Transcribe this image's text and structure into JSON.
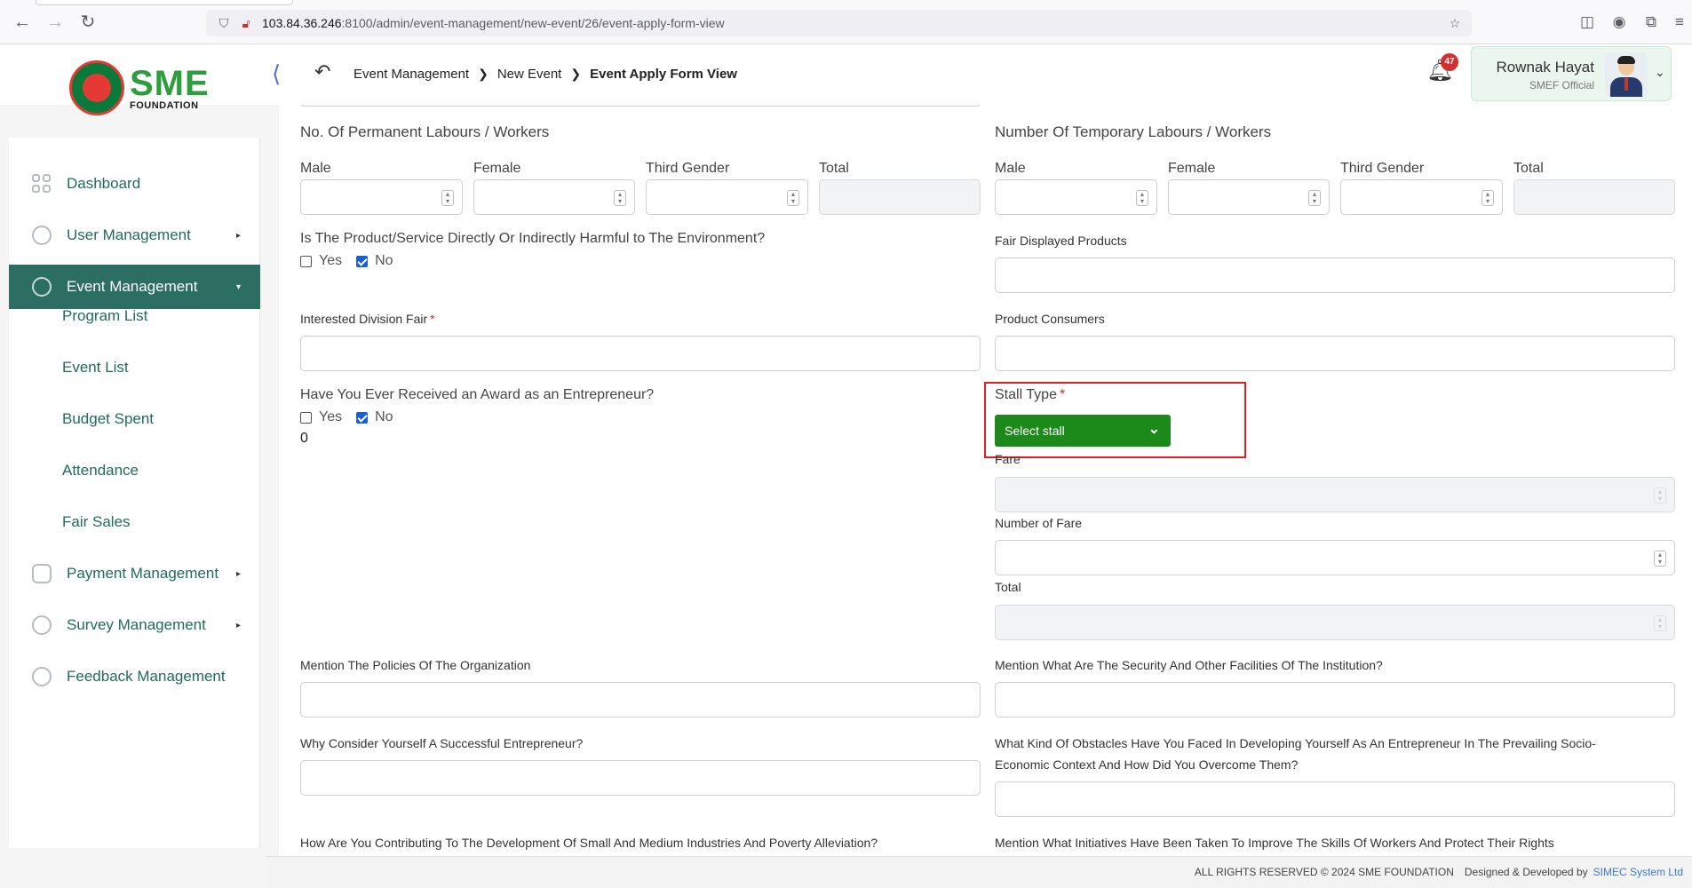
{
  "browser": {
    "url_host": "103.84.36.246",
    "url_rest": ":8100/admin/event-management/new-event/26/event-apply-form-view"
  },
  "brand": {
    "logo_text": "SME",
    "logo_sub": "FOUNDATION"
  },
  "header": {
    "breadcrumb": [
      "Event Management",
      "New Event",
      "Event Apply Form View"
    ],
    "notification_count": "47",
    "user_name": "Rownak Hayat",
    "user_role": "SMEF Official"
  },
  "sidebar": {
    "items": [
      {
        "label": "Dashboard",
        "icon": "dashboard-icon"
      },
      {
        "label": "User Management",
        "icon": "user-shield-icon",
        "caret": "▸"
      },
      {
        "label": "Event Management",
        "icon": "event-lock-icon",
        "caret": "▾",
        "active": true
      },
      {
        "label": "Payment Management",
        "icon": "payment-icon",
        "caret": "▸"
      },
      {
        "label": "Survey Management",
        "icon": "pie-chart-icon",
        "caret": "▸"
      },
      {
        "label": "Feedback Management",
        "icon": "feedback-icon"
      }
    ],
    "sub_items": [
      "Program List",
      "Event List",
      "Budget Spent",
      "Attendance",
      "Fair Sales"
    ]
  },
  "form": {
    "permanent_title": "No. Of Permanent Labours / Workers",
    "temporary_title": "Number Of Temporary Labours / Workers",
    "labour_cols": [
      "Male",
      "Female",
      "Third Gender",
      "Total"
    ],
    "harmful_question": "Is The Product/Service Directly Or Indirectly Harmful to The Environment?",
    "yes": "Yes",
    "no": "No",
    "fair_displayed_products": "Fair Displayed Products",
    "interested_division_fair": "Interested Division Fair",
    "required_mark": "*",
    "product_consumers": "Product Consumers",
    "award_question": "Have You Ever Received an Award as an Entrepreneur?",
    "award_value": "0",
    "stall_type": "Stall Type",
    "stall_select": "Select stall",
    "fare": "Fare",
    "number_of_fare": "Number of Fare",
    "total": "Total",
    "policies": "Mention The Policies Of The Organization",
    "security": "Mention What Are The Security And Other Facilities Of The Institution?",
    "successful": "Why Consider Yourself A Successful Entrepreneur?",
    "obstacles_line1": "What Kind Of Obstacles Have You Faced In Developing Yourself As An Entrepreneur In The Prevailing Socio-",
    "obstacles_line2": "Economic Context And How Did You Overcome Them?",
    "contributing": "How Are You Contributing To The Development Of Small And Medium Industries And Poverty Alleviation?",
    "initiatives": "Mention What Initiatives Have Been Taken To Improve The Skills Of Workers And Protect Their Rights"
  },
  "footer": {
    "rights": "ALL RIGHTS RESERVED © 2024 SME FOUNDATION",
    "designed": "Designed & Developed by",
    "company": "SIMEC System Ltd"
  }
}
